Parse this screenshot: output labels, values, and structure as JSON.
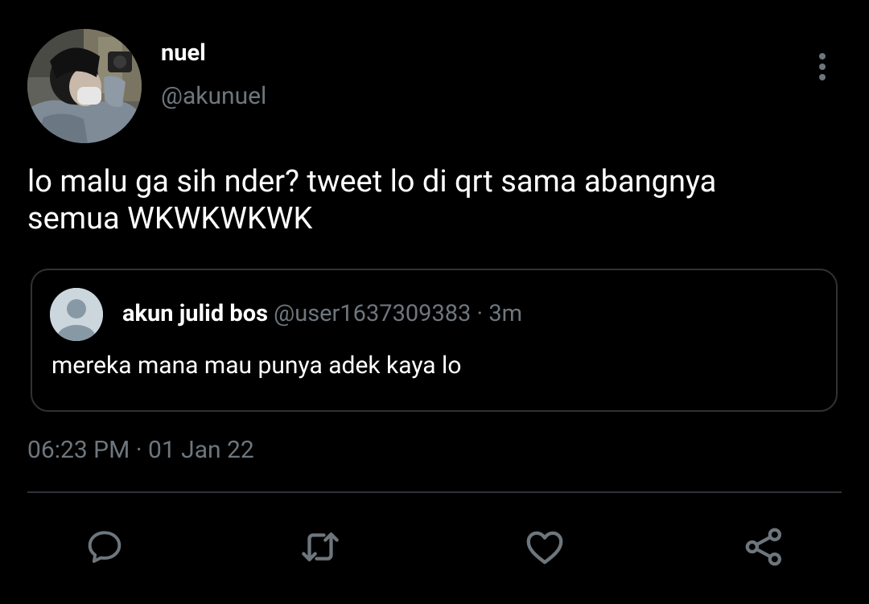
{
  "author": {
    "name": "nuel",
    "handle": "@akunuel"
  },
  "tweet": {
    "text_line1": "lo malu ga sih nder? tweet lo di qrt sama abangnya",
    "text_line2": "semua WKWKWKWK",
    "timestamp": "06:23 PM · 01 Jan 22"
  },
  "quoted_tweet": {
    "name": "akun julid bos",
    "meta": "@user1637309383 · 3m",
    "text": "mereka mana mau punya adek kaya lo"
  },
  "actions": [
    {
      "icon": "reply-icon"
    },
    {
      "icon": "retweet-icon"
    },
    {
      "icon": "like-icon"
    },
    {
      "icon": "share-icon"
    }
  ],
  "colors": {
    "background": "#000000",
    "text_primary": "#ffffff",
    "text_secondary": "#6e767d",
    "border": "#2f3336",
    "default_avatar_bg": "#ccd6dd",
    "default_avatar_fg": "#8899a6"
  }
}
